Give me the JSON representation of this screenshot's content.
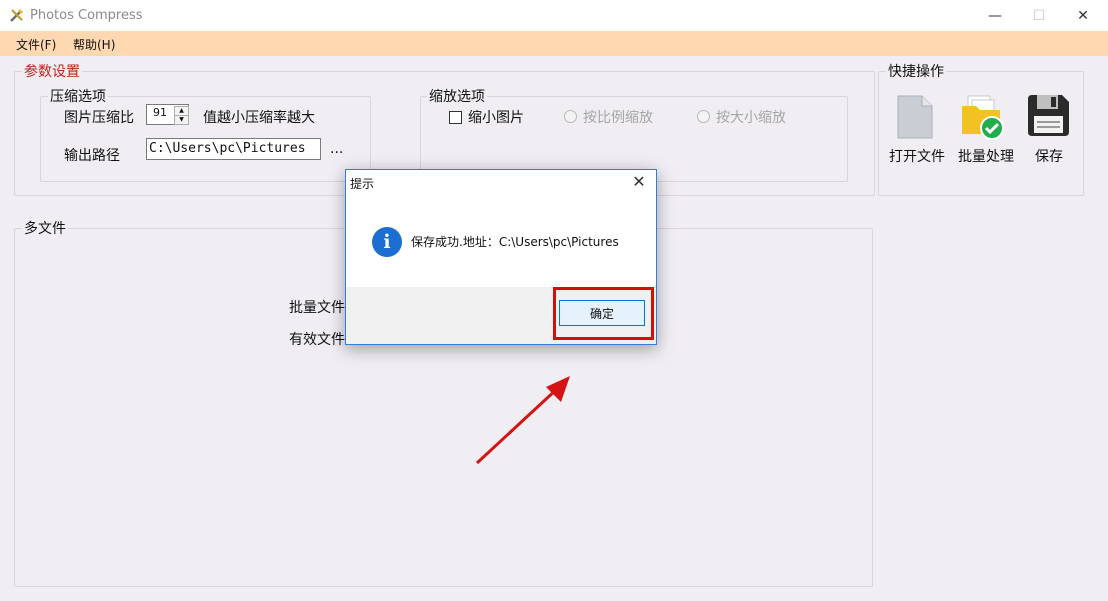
{
  "window": {
    "title": "Photos Compress",
    "minimize": "—",
    "maximize": "☐",
    "close": "✕"
  },
  "menu": {
    "file": "文件(F)",
    "help": "帮助(H)"
  },
  "params": {
    "legend": "参数设置",
    "compress": {
      "legend": "压缩选项",
      "ratio_label": "图片压缩比",
      "ratio_value": "91",
      "hint": "值越小压缩率越大",
      "output_label": "输出路径",
      "output_value": "C:\\Users\\pc\\Pictures",
      "browse": "..."
    },
    "scale": {
      "legend": "缩放选项",
      "shrink": "缩小图片",
      "by_ratio": "按比例缩放",
      "by_size": "按大小缩放"
    }
  },
  "quick": {
    "legend": "快捷操作",
    "open": "打开文件",
    "batch": "批量处理",
    "save": "保存"
  },
  "multi": {
    "legend": "多文件",
    "batch_files": "批量文件",
    "valid_files": "有效文件"
  },
  "dialog": {
    "title": "提示",
    "close": "✕",
    "message": "保存成功.地址：C:\\Users\\pc\\Pictures",
    "ok": "确定"
  },
  "colors": {
    "menubar": "#fdd8b0",
    "accent_red": "#c42020",
    "highlight_red": "#d40d0d",
    "info_blue": "#1c6fd1"
  }
}
